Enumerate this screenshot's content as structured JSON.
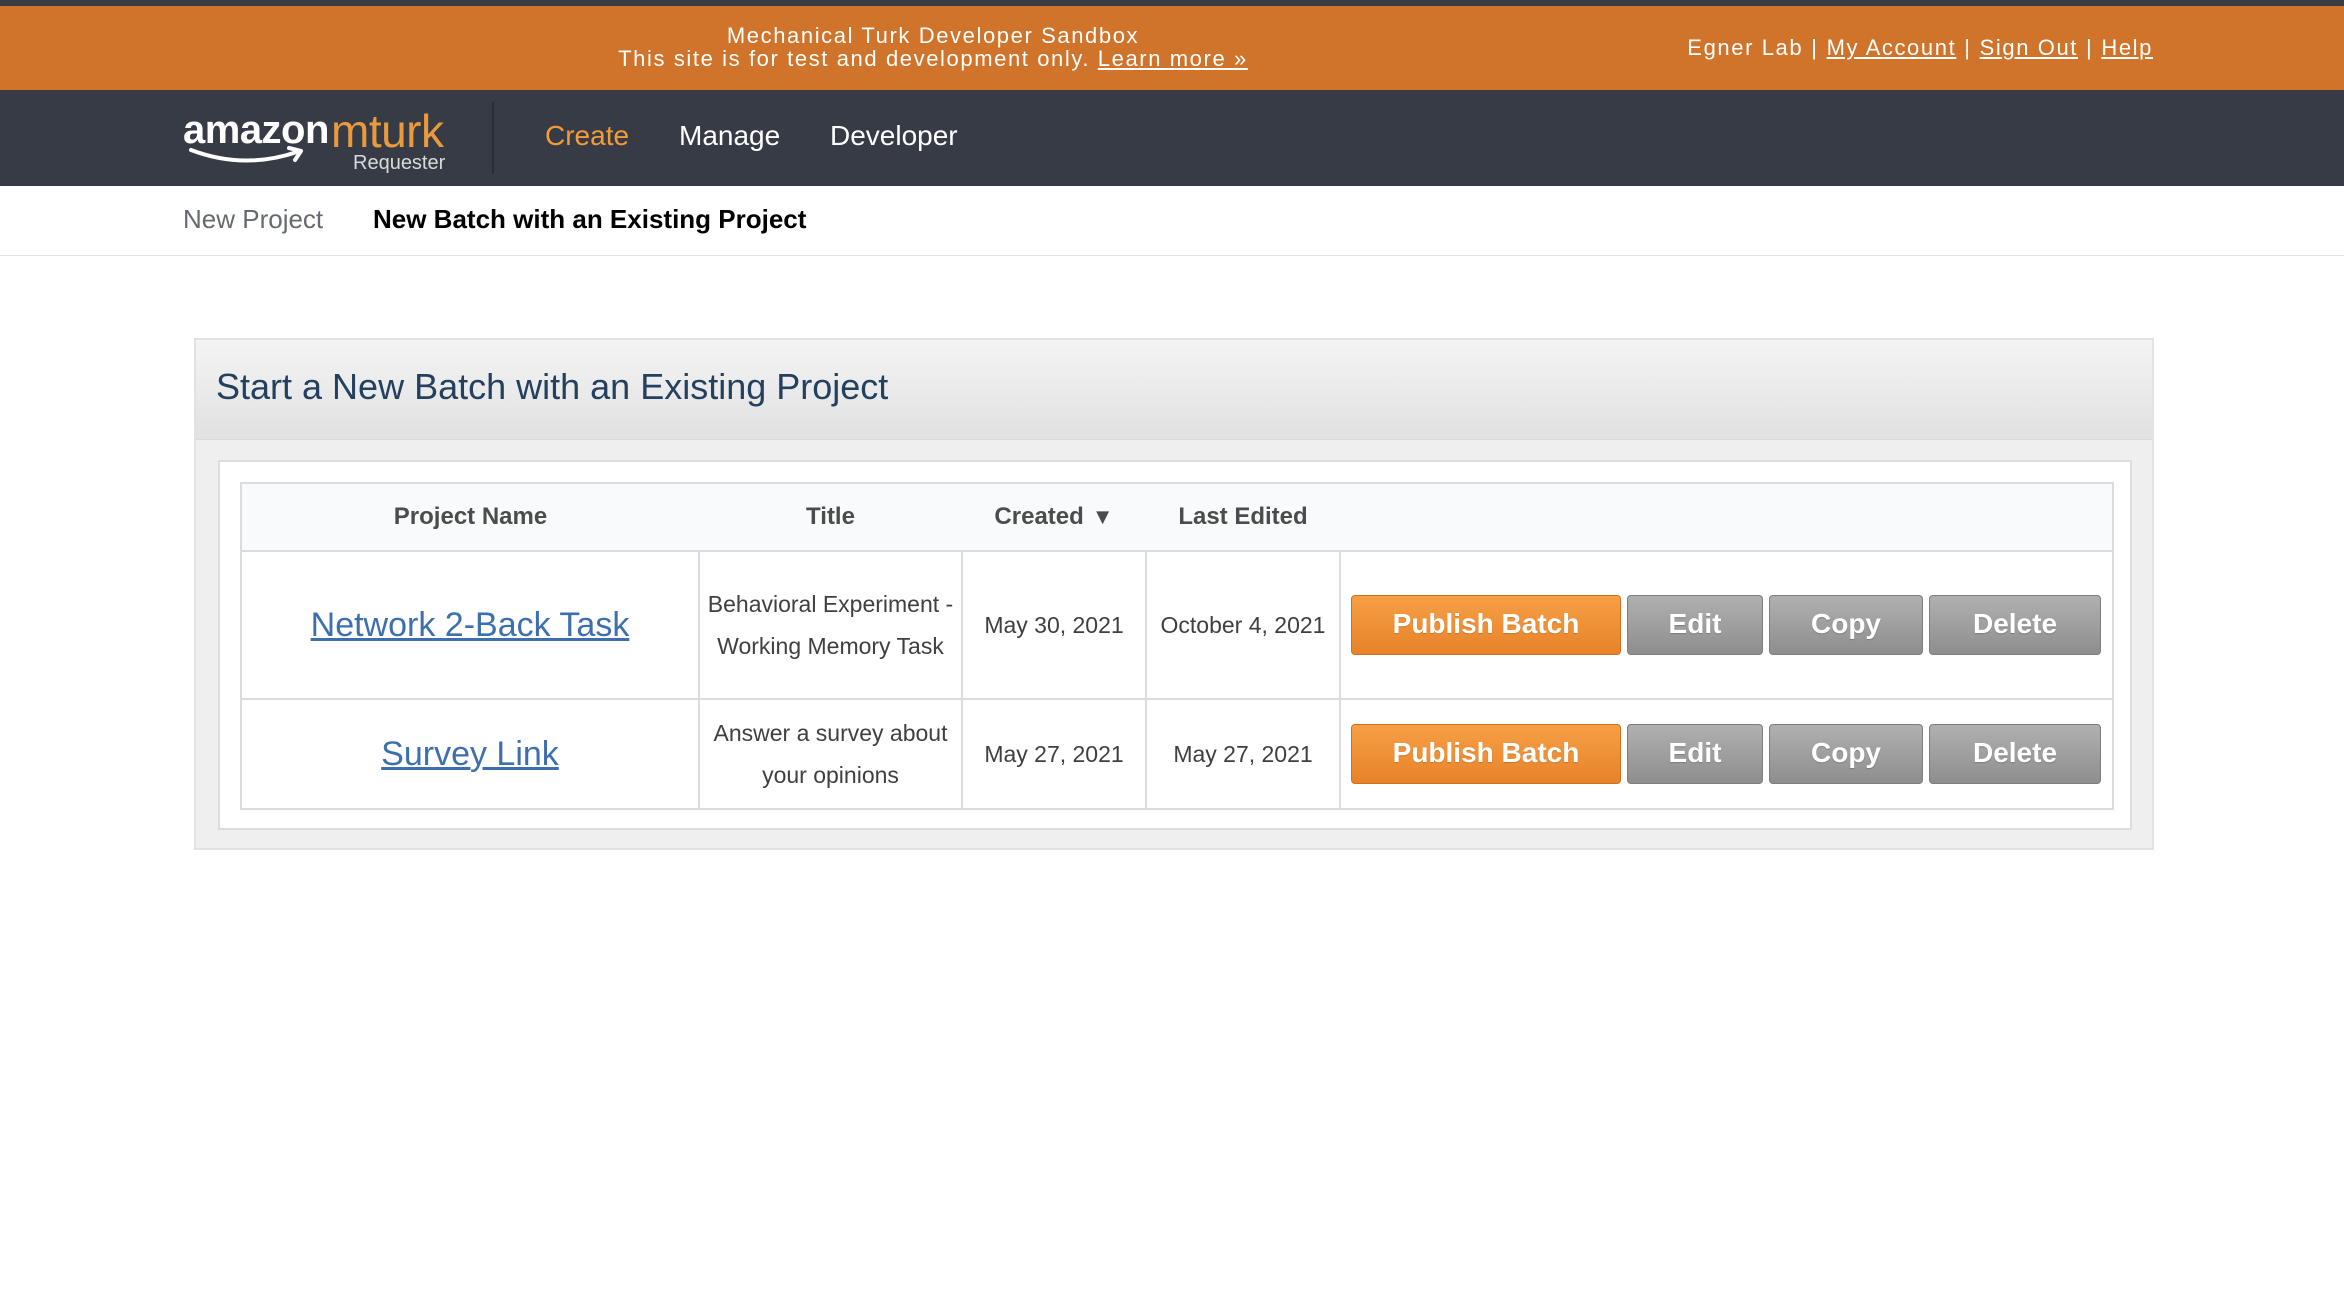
{
  "sandbox": {
    "line1": "Mechanical Turk Developer Sandbox",
    "line2": "This site is for test and development only.",
    "learn_more": "Learn more »",
    "user": "Egner Lab",
    "sep": "|",
    "my_account": "My Account",
    "sign_out": "Sign Out",
    "help": "Help"
  },
  "logo": {
    "amazon": "amazon",
    "mturk": "mturk",
    "requester": "Requester"
  },
  "nav": {
    "create": "Create",
    "manage": "Manage",
    "developer": "Developer"
  },
  "subnav": {
    "new_project": "New Project",
    "new_batch": "New Batch with an Existing Project"
  },
  "panel": {
    "title": "Start a New Batch with an Existing Project"
  },
  "table": {
    "headers": {
      "project_name": "Project Name",
      "title": "Title",
      "created": "Created",
      "sort_arrow": "▼",
      "last_edited": "Last Edited"
    },
    "rows": [
      {
        "project_name": "Network 2-Back Task",
        "title": "Behavioral Experiment - Working Memory Task",
        "created": "May 30, 2021",
        "last_edited": "October 4, 2021"
      },
      {
        "project_name": "Survey Link",
        "title": "Answer a survey about your opinions",
        "created": "May 27, 2021",
        "last_edited": "May 27, 2021"
      }
    ],
    "buttons": {
      "publish": "Publish Batch",
      "edit": "Edit",
      "copy": "Copy",
      "delete": "Delete"
    }
  },
  "colors": {
    "sandbox_bg": "#d0732b",
    "nav_bg": "#373b46",
    "nav_active": "#f39b3a",
    "link": "#3d6fb0",
    "publish_button": "#ef8f35",
    "gray_button": "#9e9e9e"
  }
}
